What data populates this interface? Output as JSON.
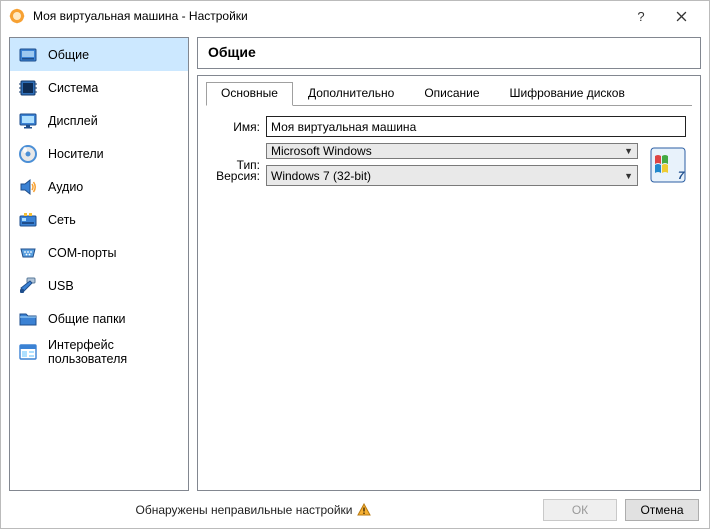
{
  "window": {
    "title": "Моя виртуальная машина - Настройки"
  },
  "sidebar": {
    "items": [
      {
        "label": "Общие"
      },
      {
        "label": "Система"
      },
      {
        "label": "Дисплей"
      },
      {
        "label": "Носители"
      },
      {
        "label": "Аудио"
      },
      {
        "label": "Сеть"
      },
      {
        "label": "COM-порты"
      },
      {
        "label": "USB"
      },
      {
        "label": "Общие папки"
      },
      {
        "label": "Интерфейс пользователя"
      }
    ],
    "selected_index": 0
  },
  "panel": {
    "heading": "Общие",
    "tabs": [
      {
        "label": "Основные"
      },
      {
        "label": "Дополнительно"
      },
      {
        "label": "Описание"
      },
      {
        "label": "Шифрование дисков"
      }
    ],
    "active_tab_index": 0,
    "form": {
      "name_label": "Имя:",
      "name_value": "Моя виртуальная машина",
      "type_label": "Тип:",
      "type_value": "Microsoft Windows",
      "version_label": "Версия:",
      "version_value": "Windows 7 (32-bit)"
    }
  },
  "footer": {
    "status_text": "Обнаружены неправильные настройки",
    "ok_label": "ОК",
    "cancel_label": "Отмена"
  }
}
